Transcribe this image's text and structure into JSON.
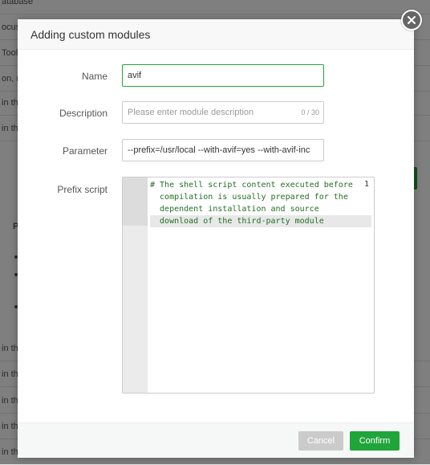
{
  "background": {
    "rows": [
      "atabase",
      "ocus",
      "Tool",
      "on, n",
      "in th",
      "in th",
      "in th",
      "in th",
      "in th",
      "in th",
      "in th"
    ],
    "bullet_label": "P"
  },
  "modal": {
    "title": "Adding custom modules",
    "fields": {
      "name": {
        "label": "Name",
        "value": "avif"
      },
      "description": {
        "label": "Description",
        "value": "",
        "placeholder": "Please enter module description",
        "counter": "0 / 30"
      },
      "parameter": {
        "label": "Parameter",
        "value": "--prefix=/usr/local --with-avif=yes --with-avif-inc"
      },
      "prefix_script": {
        "label": "Prefix script",
        "line_number": "1",
        "lines": [
          "# The shell script content executed before",
          "  compilation is usually prepared for the",
          "  dependent installation and source",
          "  download of the third-party module"
        ]
      }
    },
    "buttons": {
      "cancel": "Cancel",
      "confirm": "Confirm"
    }
  },
  "colors": {
    "accent": "#20a53a",
    "close_button": "#666666",
    "cancel_button": "#cbcbcb",
    "code_text": "#236e25"
  },
  "icons": {
    "close": "close-icon"
  }
}
